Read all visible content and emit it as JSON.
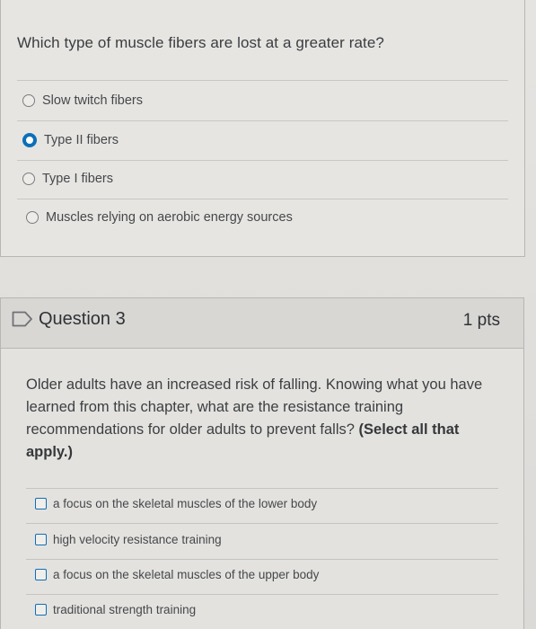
{
  "question_prev": {
    "text": "Which type of muscle fibers are lost at a greater rate?",
    "options": [
      {
        "label": "Slow twitch fibers",
        "selected": false
      },
      {
        "label": "Type II fibers",
        "selected": true
      },
      {
        "label": "Type I fibers",
        "selected": false
      },
      {
        "label": "Muscles relying on aerobic energy sources",
        "selected": false
      }
    ]
  },
  "question3": {
    "title": "Question 3",
    "points": "1 pts",
    "flag_icon": "flag-outline-icon",
    "body": "Older adults have an increased risk of falling. Knowing what you have learned from this chapter, what are the resistance training recommendations for older adults to prevent falls?",
    "body_bold": "(Select all that apply.)",
    "options": [
      {
        "label": "a focus on the skeletal muscles of the lower body",
        "checked": false
      },
      {
        "label": "high velocity resistance training",
        "checked": false
      },
      {
        "label": "a focus on the skeletal muscles of the upper body",
        "checked": false
      },
      {
        "label": "traditional strength training",
        "checked": false
      }
    ]
  },
  "colors": {
    "accent": "#0d6fb8",
    "text": "#3a3d40",
    "border": "#b8b6b3"
  }
}
